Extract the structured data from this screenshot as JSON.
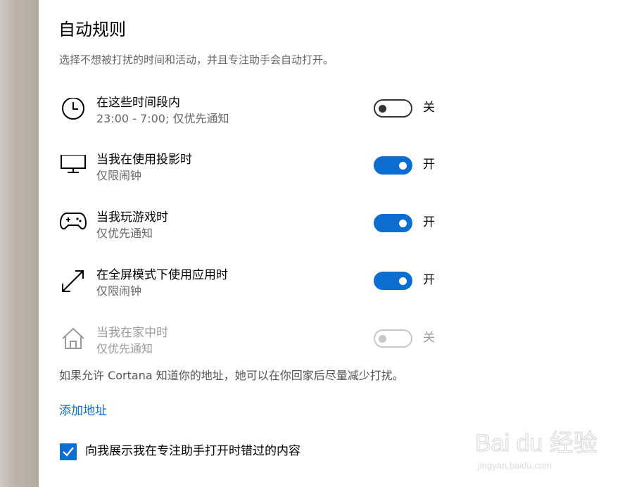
{
  "section": {
    "title": "自动规则",
    "description": "选择不想被打扰的时间和活动，并且专注助手会自动打开。"
  },
  "rules": [
    {
      "icon": "clock-icon",
      "name": "在这些时间段内",
      "sub": "23:00 - 7:00; 仅优先通知",
      "state": "关",
      "enabled": false,
      "disabled": false
    },
    {
      "icon": "monitor-icon",
      "name": "当我在使用投影时",
      "sub": "仅限闹钟",
      "state": "开",
      "enabled": true,
      "disabled": false
    },
    {
      "icon": "gamepad-icon",
      "name": "当我玩游戏时",
      "sub": "仅优先通知",
      "state": "开",
      "enabled": true,
      "disabled": false
    },
    {
      "icon": "fullscreen-arrow-icon",
      "name": "在全屏模式下使用应用时",
      "sub": "仅限闹钟",
      "state": "开",
      "enabled": true,
      "disabled": false
    },
    {
      "icon": "home-icon",
      "name": "当我在家中时",
      "sub": "仅优先通知",
      "state": "关",
      "enabled": false,
      "disabled": true
    }
  ],
  "note": {
    "text": "如果允许 Cortana 知道你的地址，她可以在你回家后尽量减少打扰。",
    "link": "添加地址"
  },
  "checkbox": {
    "label": "向我展示我在专注助手打开时错过的内容",
    "checked": true
  },
  "watermark": {
    "brand_text": "Bai du 经验",
    "url_text": "jingyan.baidu.com"
  },
  "colors": {
    "accent": "#0b6ed0",
    "secondary_text": "#666666",
    "disabled_text": "#9a9a9a"
  }
}
